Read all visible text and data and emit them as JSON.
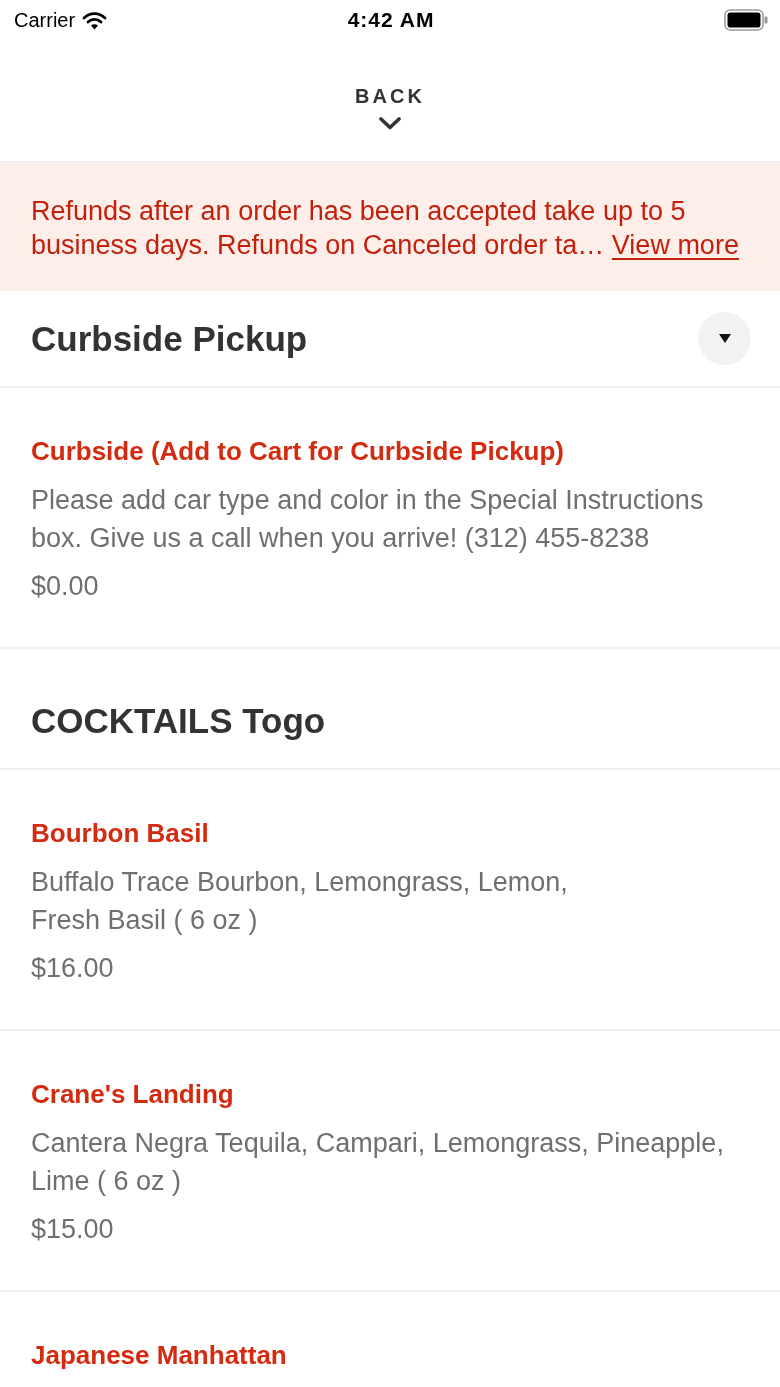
{
  "status_bar": {
    "carrier": "Carrier",
    "time": "4:42 AM"
  },
  "header": {
    "back_label": "BACK"
  },
  "notice": {
    "text": "Refunds after an order has been accepted take up to 5 business days. Refunds on Canceled order ta…",
    "link": "View more"
  },
  "sections": [
    {
      "title": "Curbside Pickup",
      "dropdown": true,
      "items": [
        {
          "name": "Curbside (Add to Cart for Curbside Pickup)",
          "description": "Please add car type and color in the Special Instructions box. Give us a call when you arrive! (312) 455-8238",
          "price": "$0.00"
        }
      ]
    },
    {
      "title": "COCKTAILS Togo",
      "dropdown": false,
      "items": [
        {
          "name": "Bourbon Basil",
          "description": "Buffalo Trace Bourbon, Lemongrass, Lemon,\nFresh Basil ( 6 oz )",
          "price": "$16.00"
        },
        {
          "name": "Crane's Landing",
          "description": "Cantera Negra Tequila, Campari, Lemongrass, Pineapple, Lime ( 6 oz )",
          "price": "$15.00"
        },
        {
          "name": "Japanese Manhattan"
        }
      ]
    }
  ]
}
